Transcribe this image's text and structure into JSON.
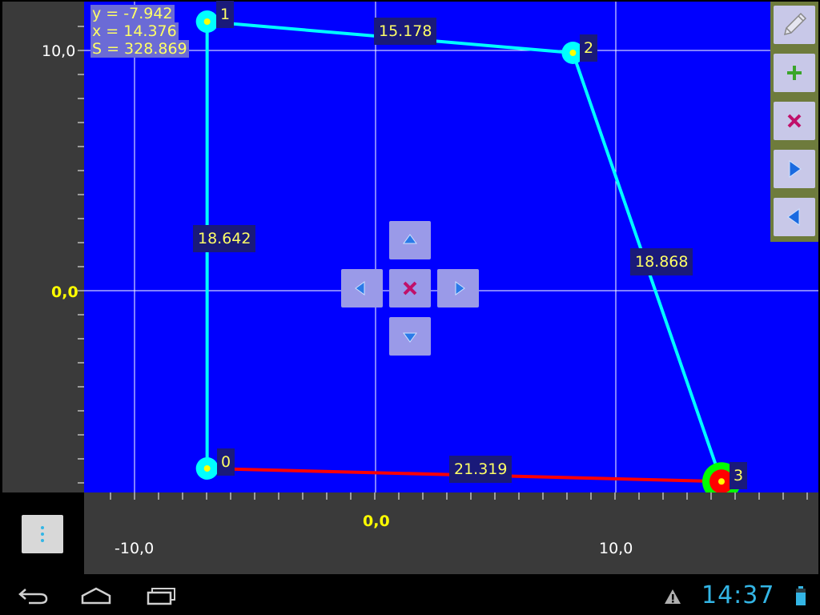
{
  "readout": {
    "y": "y = -7.942",
    "x": "x = 14.376",
    "s": "S = 328.869"
  },
  "axes": {
    "y_label_top": "10,0",
    "y_label_zero": "0,0",
    "x_label_zero": "0,0",
    "x_label_left": "-10,0",
    "x_label_right": "10,0"
  },
  "points": [
    {
      "label": "0",
      "x": -7.0,
      "y": -7.4,
      "state": "normal"
    },
    {
      "label": "1",
      "x": -7.0,
      "y": 11.2,
      "state": "normal"
    },
    {
      "label": "2",
      "x": 8.2,
      "y": 9.9,
      "state": "normal"
    },
    {
      "label": "3",
      "x": 14.376,
      "y": -7.942,
      "state": "selected"
    }
  ],
  "segments": [
    {
      "from": "0",
      "to": "1",
      "length": "18.642",
      "color": "#00ffff"
    },
    {
      "from": "1",
      "to": "2",
      "length": "15.178",
      "color": "#00ffff"
    },
    {
      "from": "2",
      "to": "3",
      "length": "18.868",
      "color": "#00ffff"
    },
    {
      "from": "3",
      "to": "0",
      "length": "21.319",
      "color": "#ff0000"
    }
  ],
  "colors": {
    "plot_background": "#0000ff",
    "grid": "#ffffff",
    "polyline": "#00ffff",
    "closing_segment": "#ff0000",
    "selected_point_ring": "#00ff00",
    "label_text": "#ffff66",
    "clock": "#33b5e5"
  },
  "toolbar": {
    "items": [
      "pencil-icon",
      "plus-icon",
      "cross-icon",
      "arrow-right-icon",
      "arrow-left-icon"
    ]
  },
  "dpad": {
    "items": [
      "arrow-up-icon",
      "arrow-left-icon",
      "cross-icon",
      "arrow-right-icon",
      "arrow-down-icon"
    ]
  },
  "status_bar": {
    "time": "14:37",
    "icons": [
      "back-icon",
      "home-icon",
      "recent-apps-icon",
      "warning-icon",
      "battery-icon"
    ]
  }
}
